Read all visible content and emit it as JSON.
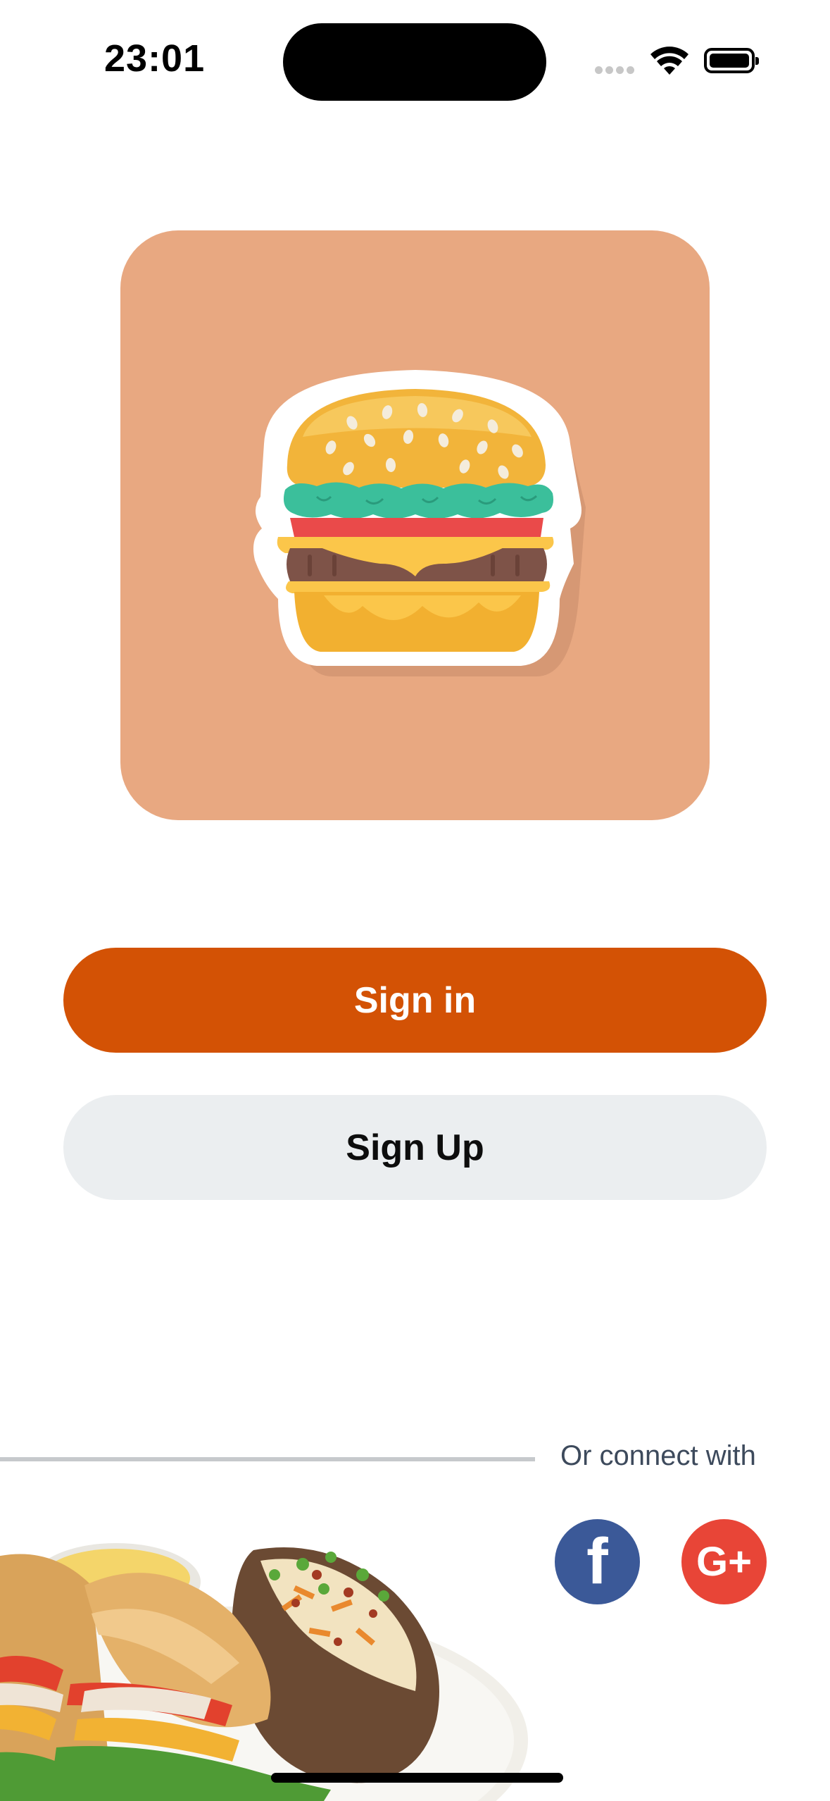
{
  "status_bar": {
    "time": "23:01",
    "icons": [
      "cellular-signal-icon",
      "wifi-icon",
      "battery-icon"
    ]
  },
  "logo": {
    "icon": "burger-icon",
    "tile_color": "#e8a881"
  },
  "actions": {
    "sign_in_label": "Sign in",
    "sign_up_label": "Sign Up"
  },
  "social": {
    "connect_text": "Or connect with",
    "facebook_glyph": "f",
    "google_glyph": "G+",
    "facebook_color": "#3b5998",
    "google_color": "#e84537"
  },
  "colors": {
    "accent": "#d35205",
    "secondary_button": "#ebeef0"
  }
}
